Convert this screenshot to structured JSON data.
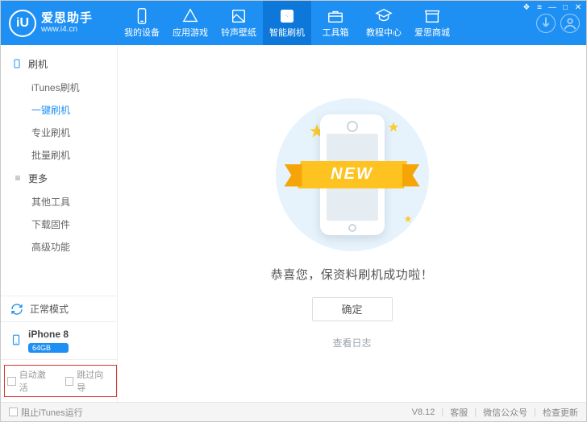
{
  "logo": {
    "glyph": "iU",
    "title": "爱思助手",
    "url": "www.i4.cn"
  },
  "nav": [
    {
      "label": "我的设备"
    },
    {
      "label": "应用游戏"
    },
    {
      "label": "铃声壁纸"
    },
    {
      "label": "智能刷机"
    },
    {
      "label": "工具箱"
    },
    {
      "label": "教程中心"
    },
    {
      "label": "爱思商城"
    }
  ],
  "sidebar": {
    "cat1": "刷机",
    "items1": [
      "iTunes刷机",
      "一键刷机",
      "专业刷机",
      "批量刷机"
    ],
    "cat2": "更多",
    "items2": [
      "其他工具",
      "下载固件",
      "高级功能"
    ],
    "mode": "正常模式",
    "device_name": "iPhone 8",
    "device_storage": "64GB",
    "auto_activate": "自动激活",
    "skip_guide": "跳过向导"
  },
  "main": {
    "ribbon_text": "NEW",
    "success_text": "恭喜您，保资料刷机成功啦！",
    "ok_btn": "确定",
    "log_link": "查看日志"
  },
  "footer": {
    "block_itunes": "阻止iTunes运行",
    "version": "V8.12",
    "support": "客服",
    "wechat": "微信公众号",
    "update": "检查更新"
  }
}
